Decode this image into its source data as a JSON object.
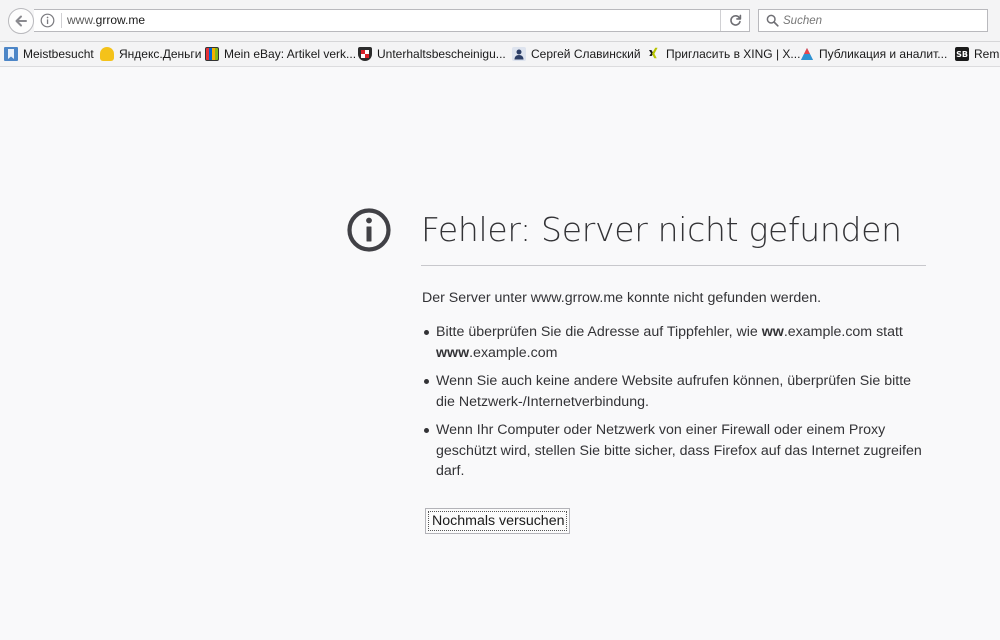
{
  "toolbar": {
    "url_prefix": "www.",
    "url_host": "grrow.me",
    "search_placeholder": "Suchen"
  },
  "bookmarks": [
    {
      "label": "Meistbesucht",
      "icon": "bookmark-folder-icon"
    },
    {
      "label": "Яндекс.Деньги",
      "icon": "yandex-money-icon"
    },
    {
      "label": "Mein eBay: Artikel verk...",
      "icon": "ebay-icon"
    },
    {
      "label": "Unterhaltsbescheinigu...",
      "icon": "shield-crest-icon"
    },
    {
      "label": "Сергей Славинский",
      "icon": "user-icon"
    },
    {
      "label": "Пригласить в XING | X...",
      "icon": "xing-icon"
    },
    {
      "label": "Публикация и аналит...",
      "icon": "triangle-logo-icon"
    },
    {
      "label": "Rem",
      "icon": "sb-logo-icon"
    }
  ],
  "error": {
    "title": "Fehler: Server nicht gefunden",
    "description": "Der Server unter www.grrow.me konnte nicht gefunden werden.",
    "bullet1_a": "Bitte überprüfen Sie die Adresse auf Tippfehler, wie ",
    "bullet1_b": "ww",
    "bullet1_c": ".example.com statt ",
    "bullet1_d": "www",
    "bullet1_e": ".example.com",
    "bullet2": "Wenn Sie auch keine andere Website aufrufen können, überprüfen Sie bitte die Netzwerk-/Internetverbindung.",
    "bullet3": "Wenn Ihr Computer oder Netzwerk von einer Firewall oder einem Proxy geschützt wird, stellen Sie bitte sicher, dass Firefox auf das Internet zugreifen darf.",
    "retry_label": "Nochmals versuchen"
  },
  "colors": {
    "page_background": "#f9f9fa",
    "text": "#333336"
  }
}
